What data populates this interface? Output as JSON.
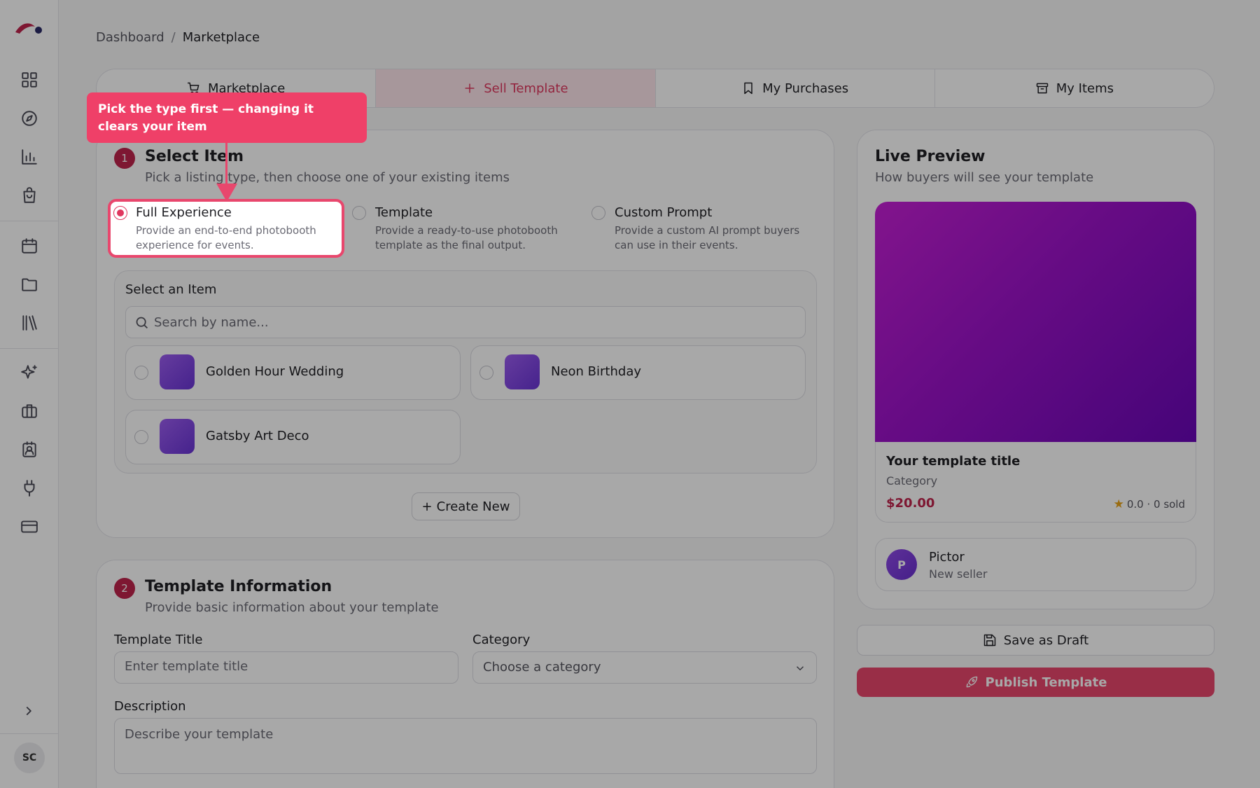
{
  "breadcrumb": {
    "parent": "Dashboard",
    "separator": "/",
    "current": "Marketplace"
  },
  "tabs": [
    {
      "label": "Marketplace",
      "icon": "cart-icon"
    },
    {
      "label": "Sell Template",
      "icon": "plus-icon",
      "active": true
    },
    {
      "label": "My Purchases",
      "icon": "bookmark-icon"
    },
    {
      "label": "My Items",
      "icon": "archive-icon"
    }
  ],
  "tooltip": {
    "text": "Pick the type first — changing it clears your item"
  },
  "select_item": {
    "step": "1",
    "title": "Select Item",
    "subtitle": "Pick a listing type, then choose one of your existing items",
    "options": [
      {
        "title": "Full Experience",
        "desc": "Provide an end-to-end photobooth experience for events.",
        "selected": true
      },
      {
        "title": "Template",
        "desc": "Provide a ready-to-use photobooth template as the final output.",
        "selected": false
      },
      {
        "title": "Custom Prompt",
        "desc": "Provide a custom AI prompt buyers can use in their events.",
        "selected": false
      }
    ],
    "panel_label": "Select an Item",
    "search_placeholder": "Search by name...",
    "items": [
      "Golden Hour Wedding",
      "Neon Birthday",
      "Gatsby Art Deco"
    ],
    "create_label": "Create New"
  },
  "template_info": {
    "step": "2",
    "title": "Template Information",
    "subtitle": "Provide basic information about your template",
    "title_label": "Template Title",
    "title_placeholder": "Enter template title",
    "category_label": "Category",
    "category_value": "Choose a category",
    "description_label": "Description",
    "description_placeholder": "Describe your template"
  },
  "preview": {
    "title": "Live Preview",
    "subtitle": "How buyers will see your template",
    "item_title": "Your template title",
    "item_category": "Category",
    "price": "$20.00",
    "stats": "0.0 · 0 sold",
    "seller_initial": "P",
    "seller_name": "Pictor",
    "seller_sub": "New seller"
  },
  "actions": {
    "draft": "Save as Draft",
    "publish": "Publish Template"
  },
  "user": {
    "initials": "SC"
  },
  "colors": {
    "accent": "#e8476d",
    "brand": "#c0244c",
    "overlay": "rgba(0,0,0,0.34)"
  }
}
